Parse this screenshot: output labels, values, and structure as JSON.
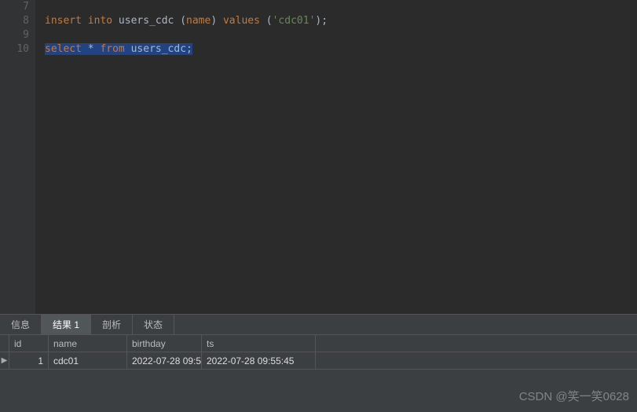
{
  "editor": {
    "lines": [
      7,
      8,
      9,
      10
    ],
    "line8": {
      "kw_insert": "insert into",
      "table": " users_cdc ",
      "paren_open": "(",
      "col": "name",
      "paren_close": ") ",
      "kw_values": "values",
      "paren_open2": " (",
      "str": "'cdc01'",
      "paren_close2": ")",
      "semi": ";"
    },
    "line10": {
      "full": "select * from users_cdc;",
      "kw_select": "select",
      "star": " * ",
      "kw_from": "from",
      "table": " users_cdc",
      "semi": ";"
    }
  },
  "tabs": {
    "info": "信息",
    "result": "结果 1",
    "profile": "剖析",
    "status": "状态"
  },
  "grid": {
    "headers": {
      "id": "id",
      "name": "name",
      "birthday": "birthday",
      "ts": "ts"
    },
    "row_indicator": "▶",
    "rows": [
      {
        "id": "1",
        "name": "cdc01",
        "birthday": "2022-07-28 09:5",
        "ts": "2022-07-28 09:55:45"
      }
    ]
  },
  "watermark": "CSDN @笑一笑0628"
}
